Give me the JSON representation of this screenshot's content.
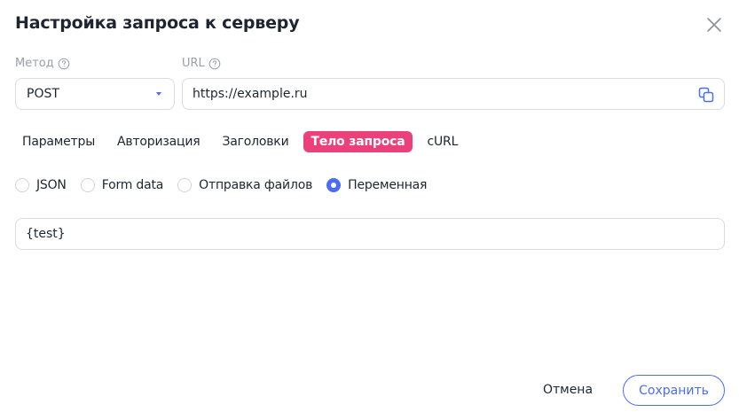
{
  "dialog": {
    "title": "Настройка запроса к серверу",
    "icons": {
      "close": "close-icon",
      "help": "help-circle-icon",
      "copy": "copy-icon"
    }
  },
  "method": {
    "label": "Метод",
    "value": "POST"
  },
  "url": {
    "label": "URL",
    "value": "https://example.ru"
  },
  "tabs": [
    {
      "label": "Параметры",
      "active": false
    },
    {
      "label": "Авторизация",
      "active": false
    },
    {
      "label": "Заголовки",
      "active": false
    },
    {
      "label": "Тело запроса",
      "active": true
    },
    {
      "label": "cURL",
      "active": false
    }
  ],
  "body_types": [
    {
      "label": "JSON",
      "checked": false
    },
    {
      "label": "Form data",
      "checked": false
    },
    {
      "label": "Отправка файлов",
      "checked": false
    },
    {
      "label": "Переменная",
      "checked": true
    }
  ],
  "body": {
    "value": "{test}"
  },
  "footer": {
    "cancel_label": "Отмена",
    "save_label": "Сохранить"
  },
  "colors": {
    "accent": "#4a6cf7",
    "active_tab": "#ec407a"
  }
}
